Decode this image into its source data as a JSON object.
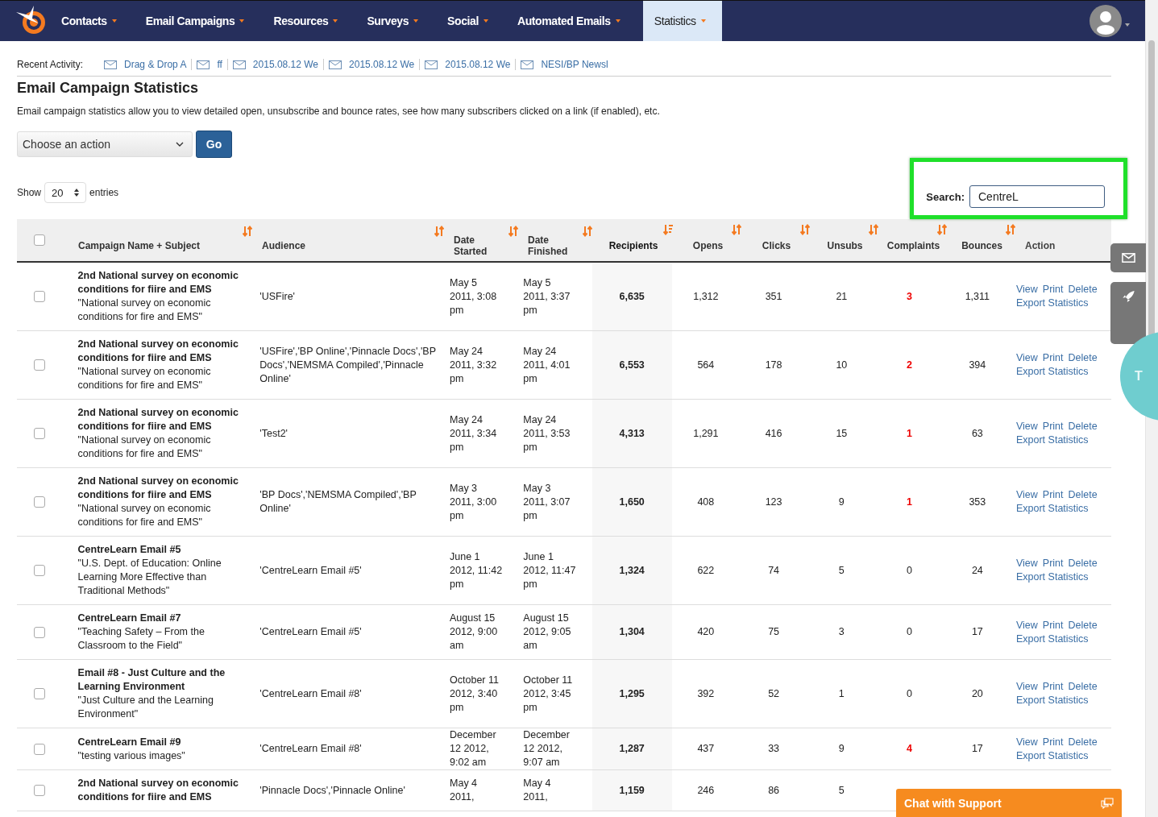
{
  "nav": {
    "items": [
      {
        "label": "Contacts",
        "selected": false
      },
      {
        "label": "Email Campaigns",
        "selected": false
      },
      {
        "label": "Resources",
        "selected": false
      },
      {
        "label": "Surveys",
        "selected": false
      },
      {
        "label": "Social",
        "selected": false
      },
      {
        "label": "Automated Emails",
        "selected": false
      },
      {
        "label": "Statistics",
        "selected": true
      }
    ]
  },
  "recent_activity": {
    "label": "Recent Activity:",
    "items": [
      "Drag & Drop A",
      "ff",
      "2015.08.12 We",
      "2015.08.12 We",
      "2015.08.12 We",
      "NESI/BP Newsl"
    ]
  },
  "title": "Email Campaign Statistics",
  "description": "Email campaign statistics allow you to view detailed open, unsubscribe and bounce rates, see how many subscribers clicked on a link (if enabled), etc.",
  "action_select": {
    "value": "Choose an action"
  },
  "go_button": "Go",
  "show_entries": {
    "label_before": "Show",
    "value": "20",
    "label_after": "entries"
  },
  "search": {
    "label": "Search:",
    "value": "CentreL",
    "highlighted": true
  },
  "table": {
    "select_all": {
      "checked": false
    },
    "columns": [
      {
        "label": "Campaign Name + Subject",
        "sortable": true,
        "sorted": false
      },
      {
        "label": "Audience",
        "sortable": true,
        "sorted": false
      },
      {
        "label": "Date Started",
        "sortable": true,
        "sorted": false
      },
      {
        "label": "Date Finished",
        "sortable": true,
        "sorted": false
      },
      {
        "label": "Recipients",
        "sortable": true,
        "sorted": true
      },
      {
        "label": "Opens",
        "sortable": true,
        "sorted": false
      },
      {
        "label": "Clicks",
        "sortable": true,
        "sorted": false
      },
      {
        "label": "Unsubs",
        "sortable": true,
        "sorted": false
      },
      {
        "label": "Complaints",
        "sortable": true,
        "sorted": false
      },
      {
        "label": "Bounces",
        "sortable": true,
        "sorted": false
      },
      {
        "label": "Action",
        "sortable": false,
        "sorted": false
      }
    ],
    "rows": [
      {
        "checked": false,
        "name": "2nd National survey on economic conditions for fiire and EMS",
        "subject": "\"National survey on economic conditions for fire and EMS\"",
        "audience": "'USFire'",
        "date_started": "May 5 2011, 3:08 pm",
        "date_finished": "May 5 2011, 3:37 pm",
        "recipients": "6,635",
        "opens": "1,312",
        "clicks": "351",
        "unsubs": "21",
        "complaints": "3",
        "complaints_alert": true,
        "bounces": "1,311",
        "actions": [
          "View",
          "Print",
          "Delete",
          "Export Statistics"
        ]
      },
      {
        "checked": false,
        "name": "2nd National survey on economic conditions for fiire and EMS",
        "subject": "\"National survey on economic conditions for fire and EMS\"",
        "audience": "'USFire','BP Online','Pinnacle Docs','BP Docs','NEMSMA Compiled','Pinnacle Online'",
        "date_started": "May 24 2011, 3:32 pm",
        "date_finished": "May 24 2011, 4:01 pm",
        "recipients": "6,553",
        "opens": "564",
        "clicks": "178",
        "unsubs": "10",
        "complaints": "2",
        "complaints_alert": true,
        "bounces": "394",
        "actions": [
          "View",
          "Print",
          "Delete",
          "Export Statistics"
        ]
      },
      {
        "checked": false,
        "name": "2nd National survey on economic conditions for fiire and EMS",
        "subject": "\"National survey on economic conditions for fire and EMS\"",
        "audience": "'Test2'",
        "date_started": "May 24 2011, 3:34 pm",
        "date_finished": "May 24 2011, 3:53 pm",
        "recipients": "4,313",
        "opens": "1,291",
        "clicks": "416",
        "unsubs": "15",
        "complaints": "1",
        "complaints_alert": true,
        "bounces": "63",
        "actions": [
          "View",
          "Print",
          "Delete",
          "Export Statistics"
        ]
      },
      {
        "checked": false,
        "name": "2nd National survey on economic conditions for fiire and EMS",
        "subject": "\"National survey on economic conditions for fire and EMS\"",
        "audience": "'BP Docs','NEMSMA Compiled','BP Online'",
        "date_started": "May 3 2011, 3:00 pm",
        "date_finished": "May 3 2011, 3:07 pm",
        "recipients": "1,650",
        "opens": "408",
        "clicks": "123",
        "unsubs": "9",
        "complaints": "1",
        "complaints_alert": true,
        "bounces": "353",
        "actions": [
          "View",
          "Print",
          "Delete",
          "Export Statistics"
        ]
      },
      {
        "checked": false,
        "name": "CentreLearn Email #5",
        "subject": "\"U.S. Dept. of Education: Online Learning More Effective than Traditional Methods\"",
        "audience": "'CentreLearn Email #5'",
        "date_started": "June 1 2012, 11:42 pm",
        "date_finished": "June 1 2012, 11:47 pm",
        "recipients": "1,324",
        "opens": "622",
        "clicks": "74",
        "unsubs": "5",
        "complaints": "0",
        "complaints_alert": false,
        "bounces": "24",
        "actions": [
          "View",
          "Print",
          "Delete",
          "Export Statistics"
        ]
      },
      {
        "checked": false,
        "name": "CentreLearn Email #7",
        "subject": "\"Teaching Safety – From the Classroom to the Field\"",
        "audience": "'CentreLearn Email #5'",
        "date_started": "August 15 2012, 9:00 am",
        "date_finished": "August 15 2012, 9:05 am",
        "recipients": "1,304",
        "opens": "420",
        "clicks": "75",
        "unsubs": "3",
        "complaints": "0",
        "complaints_alert": false,
        "bounces": "17",
        "actions": [
          "View",
          "Print",
          "Delete",
          "Export Statistics"
        ]
      },
      {
        "checked": false,
        "name": "Email #8 - Just Culture and the Learning Environment",
        "subject": "\"Just Culture and the Learning Environment\"",
        "audience": "'CentreLearn Email #8'",
        "date_started": "October 11 2012, 3:40 pm",
        "date_finished": "October 11 2012, 3:45 pm",
        "recipients": "1,295",
        "opens": "392",
        "clicks": "52",
        "unsubs": "1",
        "complaints": "0",
        "complaints_alert": false,
        "bounces": "20",
        "actions": [
          "View",
          "Print",
          "Delete",
          "Export Statistics"
        ]
      },
      {
        "checked": false,
        "name": "CentreLearn Email #9",
        "subject": "\"testing various images\"",
        "audience": "'CentreLearn Email #8'",
        "date_started": "December 12 2012, 9:02 am",
        "date_finished": "December 12 2012, 9:07 am",
        "recipients": "1,287",
        "opens": "437",
        "clicks": "33",
        "unsubs": "9",
        "complaints": "4",
        "complaints_alert": true,
        "bounces": "17",
        "actions": [
          "View",
          "Print",
          "Delete",
          "Export Statistics"
        ]
      },
      {
        "checked": false,
        "name": "2nd National survey on economic conditions for fiire and EMS",
        "audience": "'Pinnacle Docs','Pinnacle Online'",
        "date_started": "May 4 2011,",
        "date_finished": "May 4 2011,",
        "recipients": "1,159",
        "opens": "246",
        "clicks": "86",
        "unsubs": "5",
        "actions": []
      }
    ]
  },
  "side_badge": "T",
  "chat_button": "Chat with Support"
}
